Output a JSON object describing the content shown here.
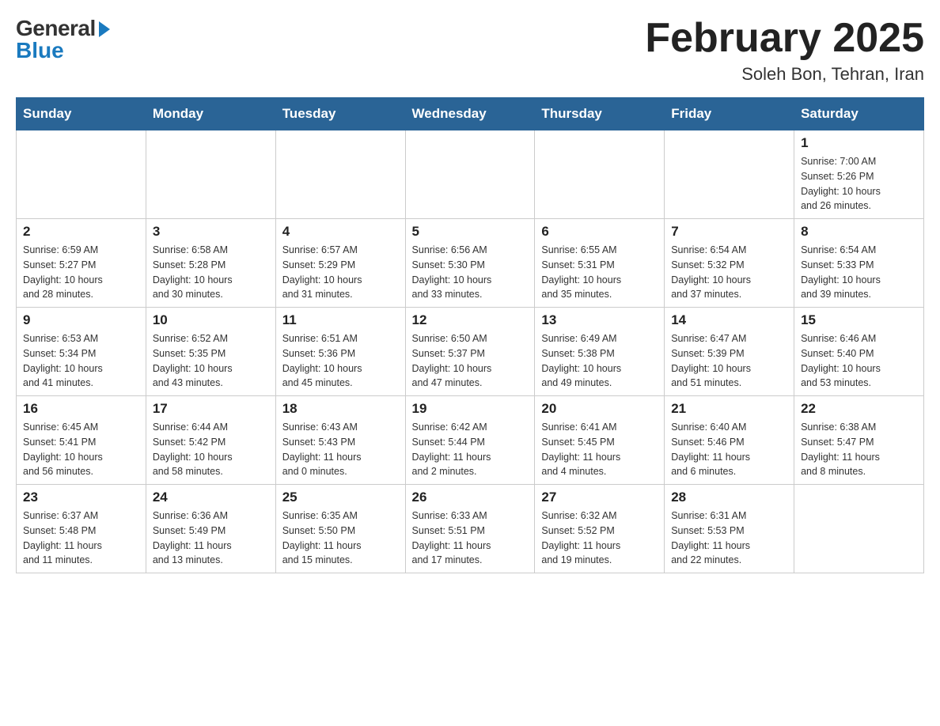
{
  "header": {
    "logo_general": "General",
    "logo_blue": "Blue",
    "title": "February 2025",
    "location": "Soleh Bon, Tehran, Iran"
  },
  "days_of_week": [
    "Sunday",
    "Monday",
    "Tuesday",
    "Wednesday",
    "Thursday",
    "Friday",
    "Saturday"
  ],
  "weeks": [
    [
      {
        "day": "",
        "info": ""
      },
      {
        "day": "",
        "info": ""
      },
      {
        "day": "",
        "info": ""
      },
      {
        "day": "",
        "info": ""
      },
      {
        "day": "",
        "info": ""
      },
      {
        "day": "",
        "info": ""
      },
      {
        "day": "1",
        "info": "Sunrise: 7:00 AM\nSunset: 5:26 PM\nDaylight: 10 hours\nand 26 minutes."
      }
    ],
    [
      {
        "day": "2",
        "info": "Sunrise: 6:59 AM\nSunset: 5:27 PM\nDaylight: 10 hours\nand 28 minutes."
      },
      {
        "day": "3",
        "info": "Sunrise: 6:58 AM\nSunset: 5:28 PM\nDaylight: 10 hours\nand 30 minutes."
      },
      {
        "day": "4",
        "info": "Sunrise: 6:57 AM\nSunset: 5:29 PM\nDaylight: 10 hours\nand 31 minutes."
      },
      {
        "day": "5",
        "info": "Sunrise: 6:56 AM\nSunset: 5:30 PM\nDaylight: 10 hours\nand 33 minutes."
      },
      {
        "day": "6",
        "info": "Sunrise: 6:55 AM\nSunset: 5:31 PM\nDaylight: 10 hours\nand 35 minutes."
      },
      {
        "day": "7",
        "info": "Sunrise: 6:54 AM\nSunset: 5:32 PM\nDaylight: 10 hours\nand 37 minutes."
      },
      {
        "day": "8",
        "info": "Sunrise: 6:54 AM\nSunset: 5:33 PM\nDaylight: 10 hours\nand 39 minutes."
      }
    ],
    [
      {
        "day": "9",
        "info": "Sunrise: 6:53 AM\nSunset: 5:34 PM\nDaylight: 10 hours\nand 41 minutes."
      },
      {
        "day": "10",
        "info": "Sunrise: 6:52 AM\nSunset: 5:35 PM\nDaylight: 10 hours\nand 43 minutes."
      },
      {
        "day": "11",
        "info": "Sunrise: 6:51 AM\nSunset: 5:36 PM\nDaylight: 10 hours\nand 45 minutes."
      },
      {
        "day": "12",
        "info": "Sunrise: 6:50 AM\nSunset: 5:37 PM\nDaylight: 10 hours\nand 47 minutes."
      },
      {
        "day": "13",
        "info": "Sunrise: 6:49 AM\nSunset: 5:38 PM\nDaylight: 10 hours\nand 49 minutes."
      },
      {
        "day": "14",
        "info": "Sunrise: 6:47 AM\nSunset: 5:39 PM\nDaylight: 10 hours\nand 51 minutes."
      },
      {
        "day": "15",
        "info": "Sunrise: 6:46 AM\nSunset: 5:40 PM\nDaylight: 10 hours\nand 53 minutes."
      }
    ],
    [
      {
        "day": "16",
        "info": "Sunrise: 6:45 AM\nSunset: 5:41 PM\nDaylight: 10 hours\nand 56 minutes."
      },
      {
        "day": "17",
        "info": "Sunrise: 6:44 AM\nSunset: 5:42 PM\nDaylight: 10 hours\nand 58 minutes."
      },
      {
        "day": "18",
        "info": "Sunrise: 6:43 AM\nSunset: 5:43 PM\nDaylight: 11 hours\nand 0 minutes."
      },
      {
        "day": "19",
        "info": "Sunrise: 6:42 AM\nSunset: 5:44 PM\nDaylight: 11 hours\nand 2 minutes."
      },
      {
        "day": "20",
        "info": "Sunrise: 6:41 AM\nSunset: 5:45 PM\nDaylight: 11 hours\nand 4 minutes."
      },
      {
        "day": "21",
        "info": "Sunrise: 6:40 AM\nSunset: 5:46 PM\nDaylight: 11 hours\nand 6 minutes."
      },
      {
        "day": "22",
        "info": "Sunrise: 6:38 AM\nSunset: 5:47 PM\nDaylight: 11 hours\nand 8 minutes."
      }
    ],
    [
      {
        "day": "23",
        "info": "Sunrise: 6:37 AM\nSunset: 5:48 PM\nDaylight: 11 hours\nand 11 minutes."
      },
      {
        "day": "24",
        "info": "Sunrise: 6:36 AM\nSunset: 5:49 PM\nDaylight: 11 hours\nand 13 minutes."
      },
      {
        "day": "25",
        "info": "Sunrise: 6:35 AM\nSunset: 5:50 PM\nDaylight: 11 hours\nand 15 minutes."
      },
      {
        "day": "26",
        "info": "Sunrise: 6:33 AM\nSunset: 5:51 PM\nDaylight: 11 hours\nand 17 minutes."
      },
      {
        "day": "27",
        "info": "Sunrise: 6:32 AM\nSunset: 5:52 PM\nDaylight: 11 hours\nand 19 minutes."
      },
      {
        "day": "28",
        "info": "Sunrise: 6:31 AM\nSunset: 5:53 PM\nDaylight: 11 hours\nand 22 minutes."
      },
      {
        "day": "",
        "info": ""
      }
    ]
  ]
}
